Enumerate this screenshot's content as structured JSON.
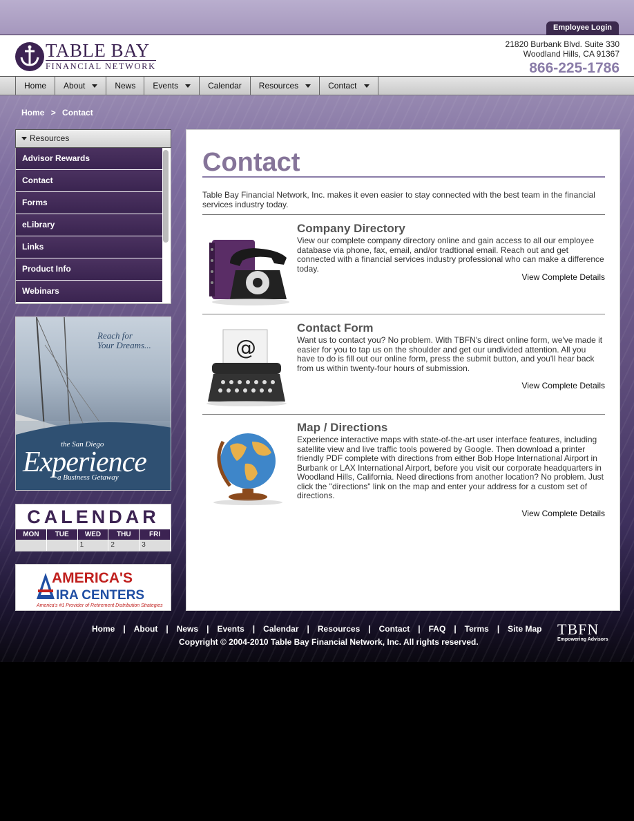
{
  "header": {
    "employee_login": "Employee Login",
    "logo_title": "TABLE BAY",
    "logo_subtitle": "FINANCIAL NETWORK",
    "address_line1": "21820 Burbank Blvd. Suite 330",
    "address_line2": "Woodland Hills, CA 91367",
    "phone": "866-225-1786"
  },
  "nav": {
    "items": [
      {
        "label": "Home",
        "dropdown": false
      },
      {
        "label": "About",
        "dropdown": true
      },
      {
        "label": "News",
        "dropdown": false
      },
      {
        "label": "Events",
        "dropdown": true
      },
      {
        "label": "Calendar",
        "dropdown": false
      },
      {
        "label": "Resources",
        "dropdown": true
      },
      {
        "label": "Contact",
        "dropdown": true
      }
    ]
  },
  "breadcrumb": {
    "home": "Home",
    "separator": ">",
    "current": "Contact"
  },
  "sidebar": {
    "header": "Resources",
    "items": [
      "Advisor Rewards",
      "Contact",
      "Forms",
      "eLibrary",
      "Links",
      "Product Info",
      "Webinars"
    ]
  },
  "promo_sd": {
    "reach_line1": "Reach for",
    "reach_line2": "Your Dreams...",
    "the_sd": "the San Diego",
    "experience": "Experience",
    "getaway": "a Business Getaway"
  },
  "calendar_promo": {
    "title": "CALENDAR",
    "days": [
      "MON",
      "TUE",
      "WED",
      "THU",
      "FRI"
    ],
    "numbers": [
      "",
      "",
      "1",
      "2",
      "3"
    ]
  },
  "ira_promo": {
    "line1": "AMERICA'S",
    "line2": "IRA CENTERS",
    "tagline": "America's #1 Provider of Retirement Distribution Strategies"
  },
  "main": {
    "title": "Contact",
    "intro": "Table Bay Financial Network, Inc. makes it even easier to stay connected with the best team in the financial services industry today.",
    "sections": [
      {
        "icon": "telephone-icon",
        "title": "Company Directory",
        "text": "View our complete company directory online and gain access to all our employee database via phone, fax, email, and/or tradtional email. Reach out and get connected with a financial services industry professional who can make a difference today.",
        "link": "View Complete Details"
      },
      {
        "icon": "typewriter-icon",
        "title": "Contact Form",
        "text": "Want us to contact you? No problem. With TBFN's direct online form, we've made it easier for you to tap us on the shoulder and get our undivided attention. All you have to do is fill out our online form, press the submit button, and you'll hear back from us within twenty-four hours of submission.",
        "link": "View Complete Details"
      },
      {
        "icon": "globe-icon",
        "title": "Map / Directions",
        "text": "Experience interactive maps with state-of-the-art user interface features, including satellite view and live traffic tools powered by Google. Then download a printer friendly PDF complete with directions from either Bob Hope International Airport in Burbank or LAX International Airport, before you visit our corporate headquarters in Woodland Hills, California. Need directions from another location? No problem. Just click the \"directions\" link on the map and enter your address for a custom set of directions.",
        "link": "View Complete Details"
      }
    ]
  },
  "footer": {
    "links": [
      "Home",
      "About",
      "News",
      "Events",
      "Calendar",
      "Resources",
      "Contact",
      "FAQ",
      "Terms",
      "Site Map"
    ],
    "separator": "|",
    "copyright": "Copyright © 2004-2010 Table Bay Financial Network, Inc. All rights reserved.",
    "logo_text": "TBFN",
    "logo_tagline": "Empowering Advisors"
  },
  "colors": {
    "brand_purple": "#3c2352",
    "title_purple": "#857499",
    "phone_purple": "#8a7ca8"
  }
}
